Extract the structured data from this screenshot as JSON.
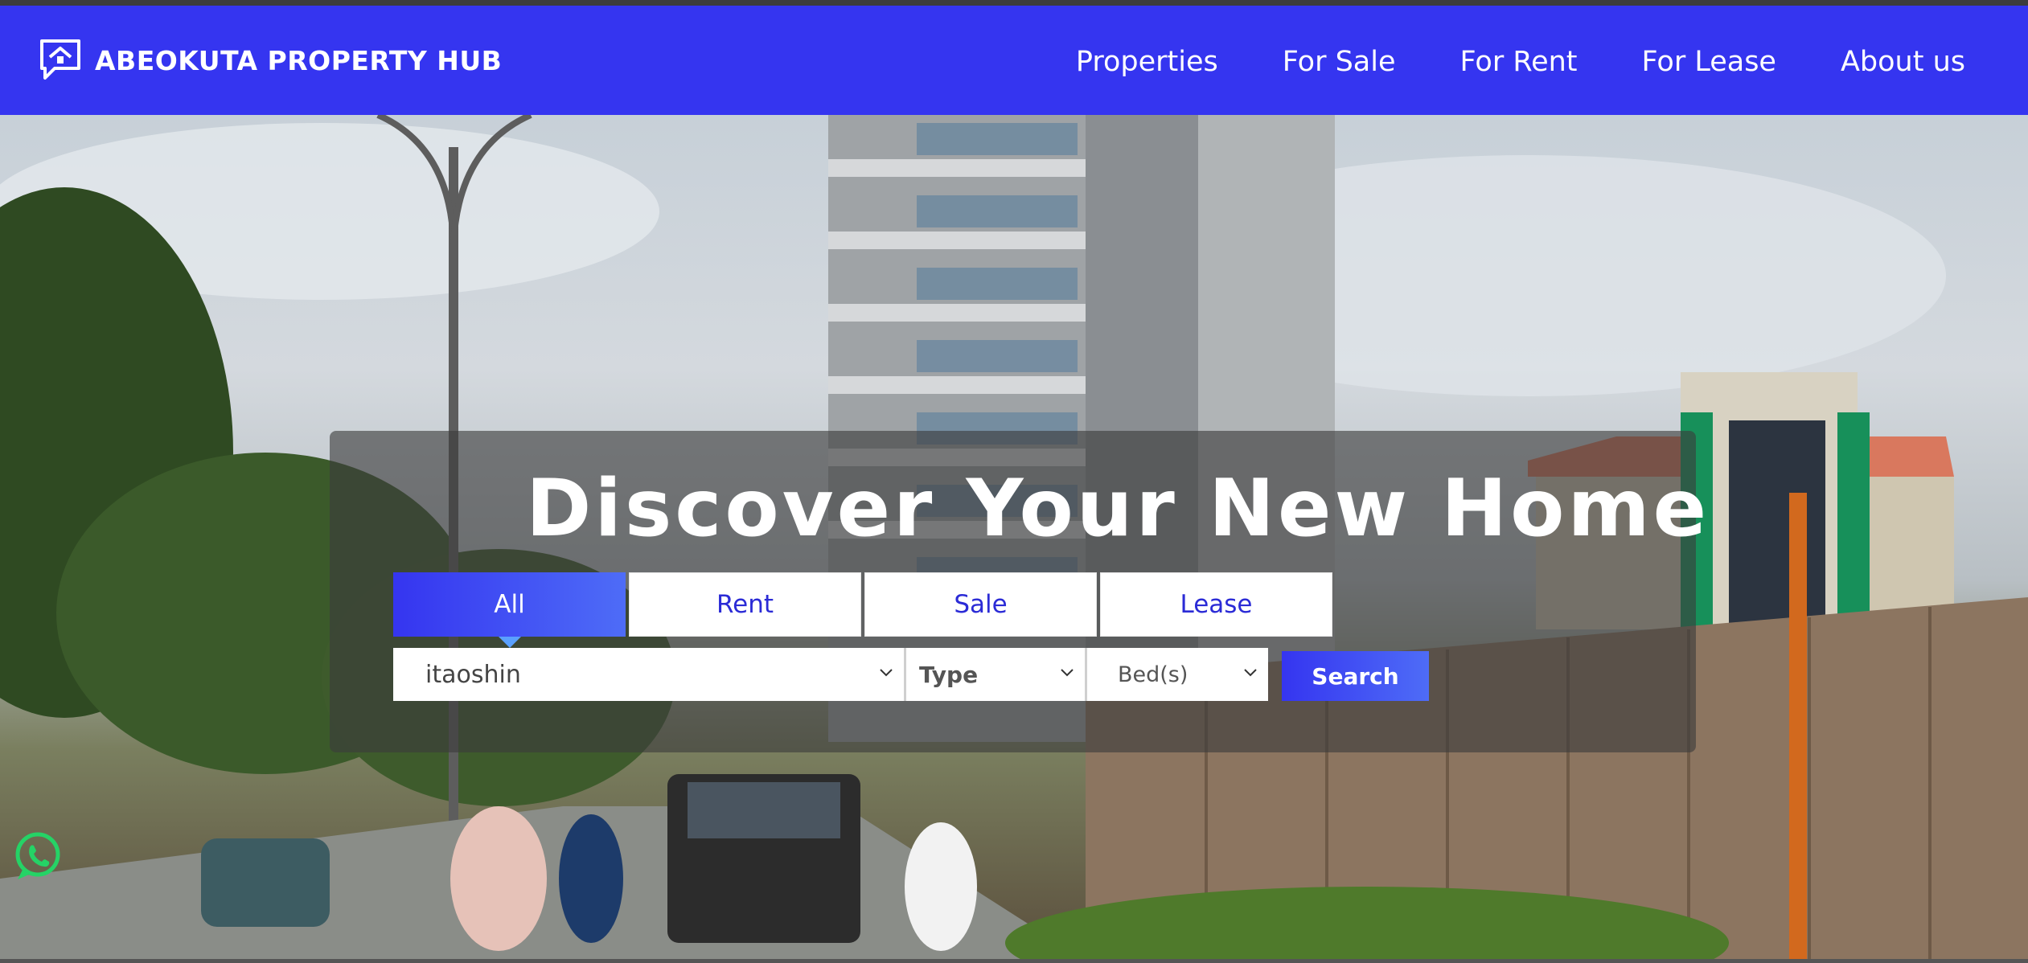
{
  "brand": {
    "name": "ABEOKUTA PROPERTY HUB",
    "logo_icon": "house-chat-icon"
  },
  "nav": [
    {
      "label": "Properties"
    },
    {
      "label": "For Sale"
    },
    {
      "label": "For Rent"
    },
    {
      "label": "For Lease"
    },
    {
      "label": "About us"
    }
  ],
  "hero": {
    "headline": "Discover Your New Home",
    "tabs": [
      {
        "label": "All",
        "active": true
      },
      {
        "label": "Rent",
        "active": false
      },
      {
        "label": "Sale",
        "active": false
      },
      {
        "label": "Lease",
        "active": false
      }
    ],
    "filters": {
      "location": "itaoshin",
      "type": "Type",
      "beds": "Bed(s)"
    },
    "search_label": "Search"
  },
  "colors": {
    "brand": "#3535f0",
    "accent": "#4e6cf7",
    "whatsapp": "#25d366"
  },
  "floating": {
    "icon": "whatsapp-icon"
  }
}
